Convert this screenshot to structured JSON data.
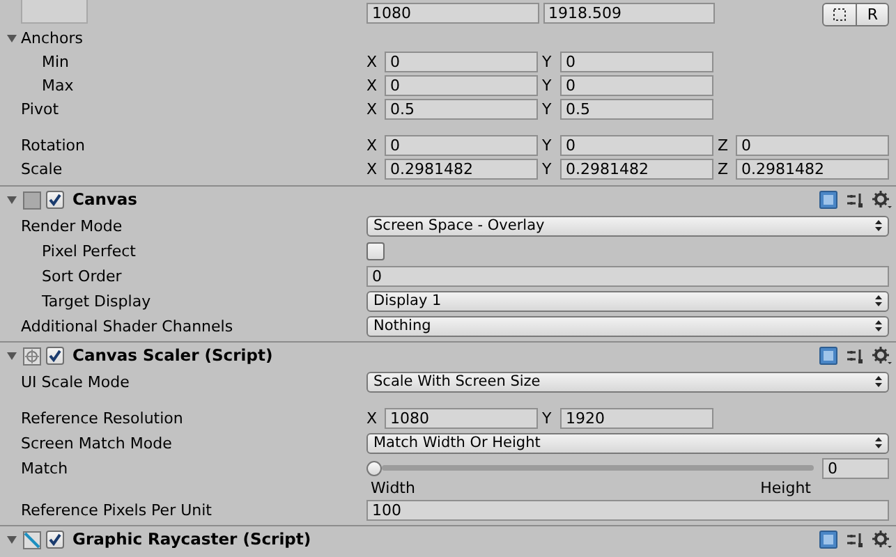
{
  "top_row": {
    "fields": [
      {
        "value": "1080"
      },
      {
        "value": "1918.509"
      }
    ],
    "buttons": [
      {
        "kind": "blueprint"
      },
      {
        "kind": "text",
        "label": "R"
      }
    ]
  },
  "transform_groups": [
    [
      {
        "kind": "foldout",
        "label": "Anchors",
        "expanded": true
      },
      {
        "kind": "vector",
        "label": "Min",
        "indented": true,
        "fields": [
          {
            "axis": "X",
            "value": "0"
          },
          {
            "axis": "Y",
            "value": "0"
          }
        ]
      },
      {
        "kind": "vector",
        "label": "Max",
        "indented": true,
        "fields": [
          {
            "axis": "X",
            "value": "0"
          },
          {
            "axis": "Y",
            "value": "0"
          }
        ]
      },
      {
        "kind": "vector",
        "label": "Pivot",
        "fields": [
          {
            "axis": "X",
            "value": "0.5"
          },
          {
            "axis": "Y",
            "value": "0.5"
          }
        ]
      }
    ],
    [
      {
        "kind": "vector",
        "label": "Rotation",
        "fields": [
          {
            "axis": "X",
            "value": "0"
          },
          {
            "axis": "Y",
            "value": "0"
          },
          {
            "axis": "Z",
            "value": "0"
          }
        ]
      },
      {
        "kind": "vector",
        "label": "Scale",
        "fields": [
          {
            "axis": "X",
            "value": "0.2981482"
          },
          {
            "axis": "Y",
            "value": "0.2981482"
          },
          {
            "axis": "Z",
            "value": "0.2981482"
          }
        ]
      }
    ]
  ],
  "components": [
    {
      "title": "Canvas",
      "kind": "canvas",
      "expanded": true,
      "enabled": true,
      "groups": [
        [
          {
            "kind": "dropdown",
            "label": "Render Mode",
            "value": "Screen Space - Overlay"
          },
          {
            "kind": "checkbox",
            "label": "Pixel Perfect",
            "indented": true,
            "checked": false
          },
          {
            "kind": "number",
            "label": "Sort Order",
            "indented": true,
            "value": "0"
          },
          {
            "kind": "dropdown",
            "label": "Target Display",
            "indented": true,
            "value": "Display 1"
          },
          {
            "kind": "dropdown",
            "label": "Additional Shader Channels",
            "value": "Nothing"
          }
        ]
      ]
    },
    {
      "title": "Canvas Scaler (Script)",
      "kind": "scaler",
      "expanded": true,
      "enabled": true,
      "groups": [
        [
          {
            "kind": "dropdown",
            "label": "UI Scale Mode",
            "value": "Scale With Screen Size"
          }
        ],
        [
          {
            "kind": "vector",
            "label": "Reference Resolution",
            "fields": [
              {
                "axis": "X",
                "value": "1080"
              },
              {
                "axis": "Y",
                "value": "1920"
              }
            ]
          },
          {
            "kind": "dropdown",
            "label": "Screen Match Mode",
            "value": "Match Width Or Height"
          },
          {
            "kind": "slider",
            "label": "Match",
            "level": 0,
            "value": "0",
            "min_label": "Width",
            "max_label": "Height"
          },
          {
            "kind": "number",
            "label": "Reference Pixels Per Unit",
            "value": "100"
          }
        ]
      ]
    },
    {
      "title": "Graphic Raycaster (Script)",
      "kind": "raycaster",
      "expanded": true,
      "enabled": true
    }
  ]
}
